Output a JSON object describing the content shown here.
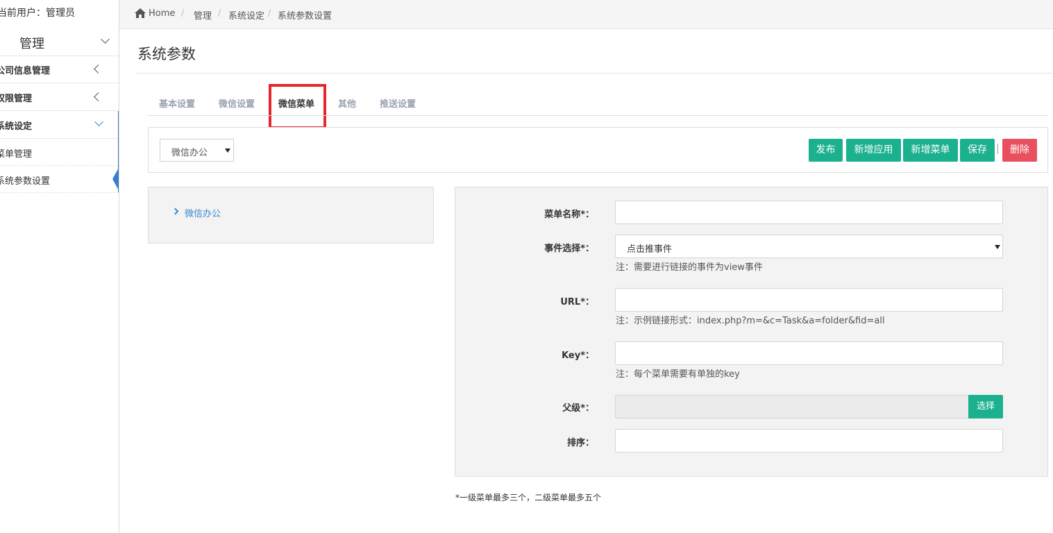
{
  "sidebar": {
    "current_user": "当前用户：管理员",
    "menu_title": "管理",
    "items": [
      {
        "label": "公司信息管理"
      },
      {
        "label": "权限管理"
      },
      {
        "label": "系统设定"
      }
    ],
    "sub_items": [
      {
        "label": "菜单管理"
      },
      {
        "label": "系统参数设置"
      }
    ]
  },
  "breadcrumb": {
    "home": "Home",
    "items": [
      "管理",
      "系统设定",
      "系统参数设置"
    ],
    "separator": "/"
  },
  "page": {
    "title": "系统参数"
  },
  "tabs": [
    {
      "label": "基本设置",
      "active": false
    },
    {
      "label": "微信设置",
      "active": false
    },
    {
      "label": "微信菜单",
      "active": true
    },
    {
      "label": "其他",
      "active": false
    },
    {
      "label": "推送设置",
      "active": false
    }
  ],
  "toolbar": {
    "app_select_value": "微信办公",
    "buttons": {
      "publish": "发布",
      "add_app": "新增应用",
      "add_menu": "新增菜单",
      "save": "保存",
      "delete": "删除"
    }
  },
  "tree": {
    "root": "微信办公"
  },
  "form": {
    "menu_name_label": "菜单名称*：",
    "menu_name_value": "",
    "event_label": "事件选择*：",
    "event_value": "点击推事件",
    "event_note": "注：需要进行链接的事件为view事件",
    "url_label": "URL*：",
    "url_value": "",
    "url_note": "注：示例链接形式：index.php?m=&c=Task&a=folder&fid=all",
    "key_label": "Key*：",
    "key_value": "",
    "key_note": "注：每个菜单需要有单独的key",
    "parent_label": "父级*：",
    "parent_value": "",
    "parent_pick": "选择",
    "order_label": "排序：",
    "order_value": ""
  },
  "footer_note": "*一级菜单最多三个，二级菜单最多五个",
  "colors": {
    "accent_green": "#1bb08e",
    "danger_red": "#e8505f",
    "highlight_red": "#e6262c",
    "link_blue": "#3a8ad0"
  }
}
